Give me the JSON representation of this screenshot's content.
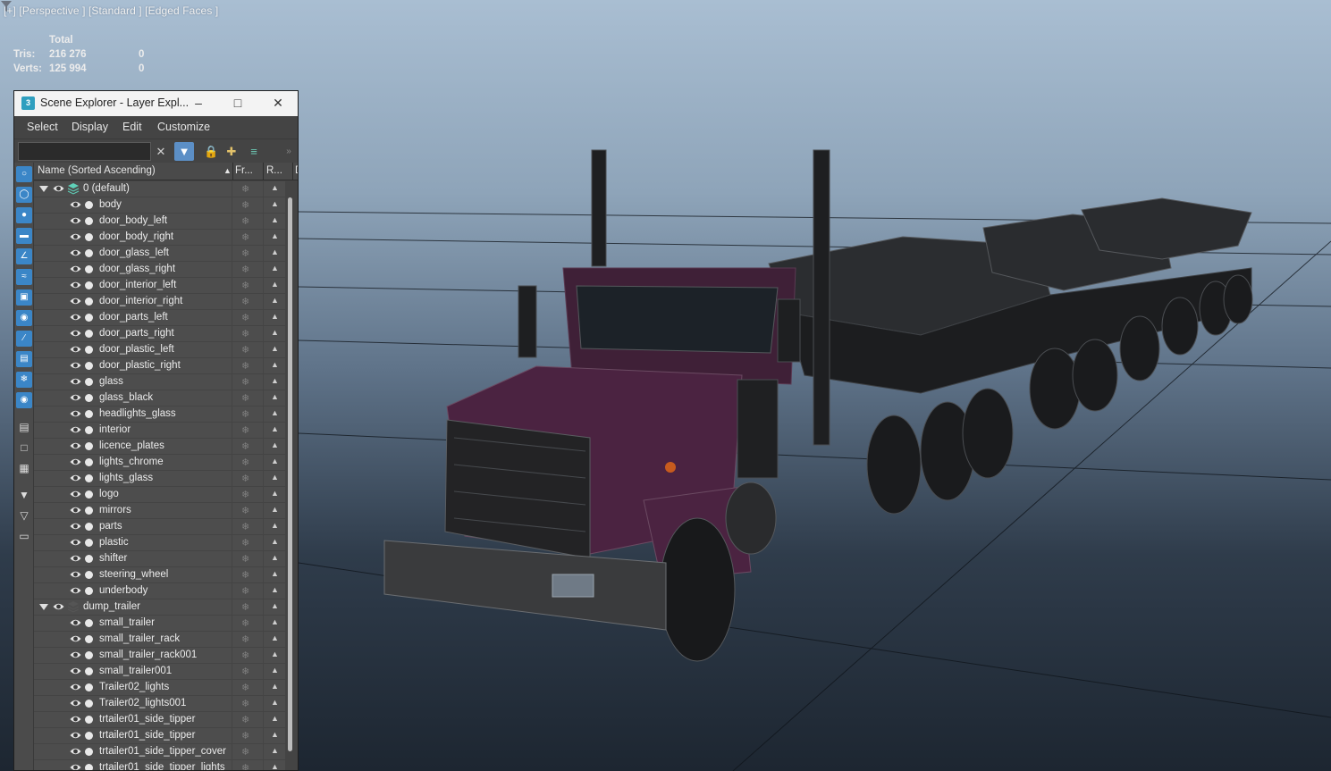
{
  "viewport": {
    "label": "[+] [Perspective ] [Standard ] [Edged Faces ]",
    "filter_icon": "funnel-icon",
    "stats": {
      "header": "Total",
      "tris_label": "Tris:",
      "tris_value": "216 276",
      "tris_selected": "0",
      "verts_label": "Verts:",
      "verts_value": "125 994",
      "verts_selected": "0"
    }
  },
  "explorer": {
    "title": "Scene Explorer - Layer Expl...",
    "menu": [
      "Select",
      "Display",
      "Edit",
      "Customize"
    ],
    "search": {
      "value": "",
      "placeholder": ""
    },
    "columns": {
      "name": "Name (Sorted Ascending)",
      "frozen": "Fr...",
      "render": "R...",
      "extra": "D"
    },
    "layers": [
      {
        "name": "0 (default)",
        "objects": [
          "body",
          "door_body_left",
          "door_body_right",
          "door_glass_left",
          "door_glass_right",
          "door_interior_left",
          "door_interior_right",
          "door_parts_left",
          "door_parts_right",
          "door_plastic_left",
          "door_plastic_right",
          "glass",
          "glass_black",
          "headlights_glass",
          "interior",
          "licence_plates",
          "lights_chrome",
          "lights_glass",
          "logo",
          "mirrors",
          "parts",
          "plastic",
          "shifter",
          "steering_wheel",
          "underbody"
        ]
      },
      {
        "name": "dump_trailer",
        "objects": [
          "small_trailer",
          "small_trailer_rack",
          "small_trailer_rack001",
          "small_trailer001",
          "Trailer02_lights",
          "Trailer02_lights001",
          "trtailer01_side_tipper",
          "trtailer01_side_tipper",
          "trtailer01_side_tipper_cover",
          "trtailer01_side_tipper_lights"
        ]
      }
    ]
  },
  "colors": {
    "accent": "#3b86c7",
    "panel": "#444444",
    "row": "#4d4d4d",
    "stats": "#253f75",
    "body_purple": "#4b2341"
  }
}
